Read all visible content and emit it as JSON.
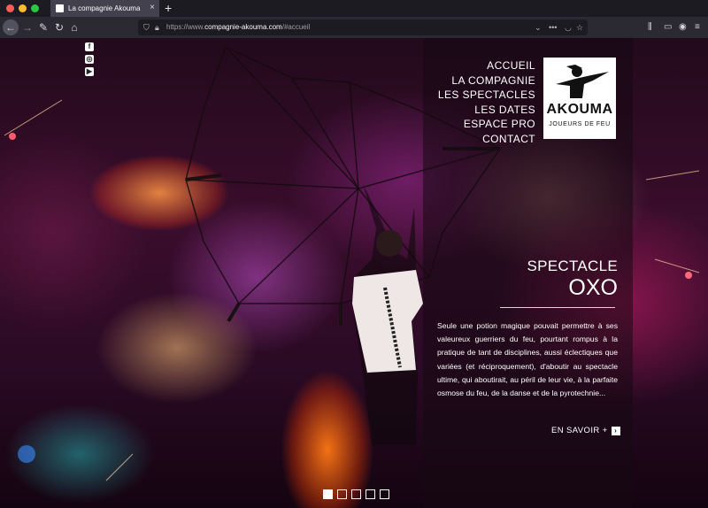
{
  "browser": {
    "tab_title": "La compagnie Akouma",
    "tab_close": "×",
    "new_tab": "+",
    "url_prefix": "https://www.",
    "url_domain": "compagnie-akouma.com",
    "url_suffix": "/#accueil",
    "traffic_lights": [
      "#ff5f57",
      "#febc2e",
      "#28c840"
    ]
  },
  "social": {
    "facebook": "f",
    "instagram": "◎",
    "youtube": "▶"
  },
  "menu": {
    "items": [
      {
        "label": "ACCUEIL"
      },
      {
        "label": "LA COMPAGNIE"
      },
      {
        "label": "LES SPECTACLES"
      },
      {
        "label": "LES DATES"
      },
      {
        "label": "ESPACE PRO"
      },
      {
        "label": "CONTACT"
      }
    ]
  },
  "logo": {
    "word": "AKOUMA",
    "subtitle": "JOUEURS DE FEU"
  },
  "feature": {
    "label": "SPECTACLE",
    "title": "OXO",
    "description": "Seule une potion magique pouvait permettre à ses valeureux guerriers du feu, pourtant rompus à la pratique de tant de disciplines, aussi éclectiques que variées (et réciproquement), d'aboutir au spectacle ultime, qui aboutirait, au péril de leur vie, à la parfaite osmose du feu, de la danse et de la pyrotechnie...",
    "more_label": "EN SAVOIR +",
    "more_icon": "›"
  },
  "slider": {
    "count": 5,
    "active_index": 0
  }
}
